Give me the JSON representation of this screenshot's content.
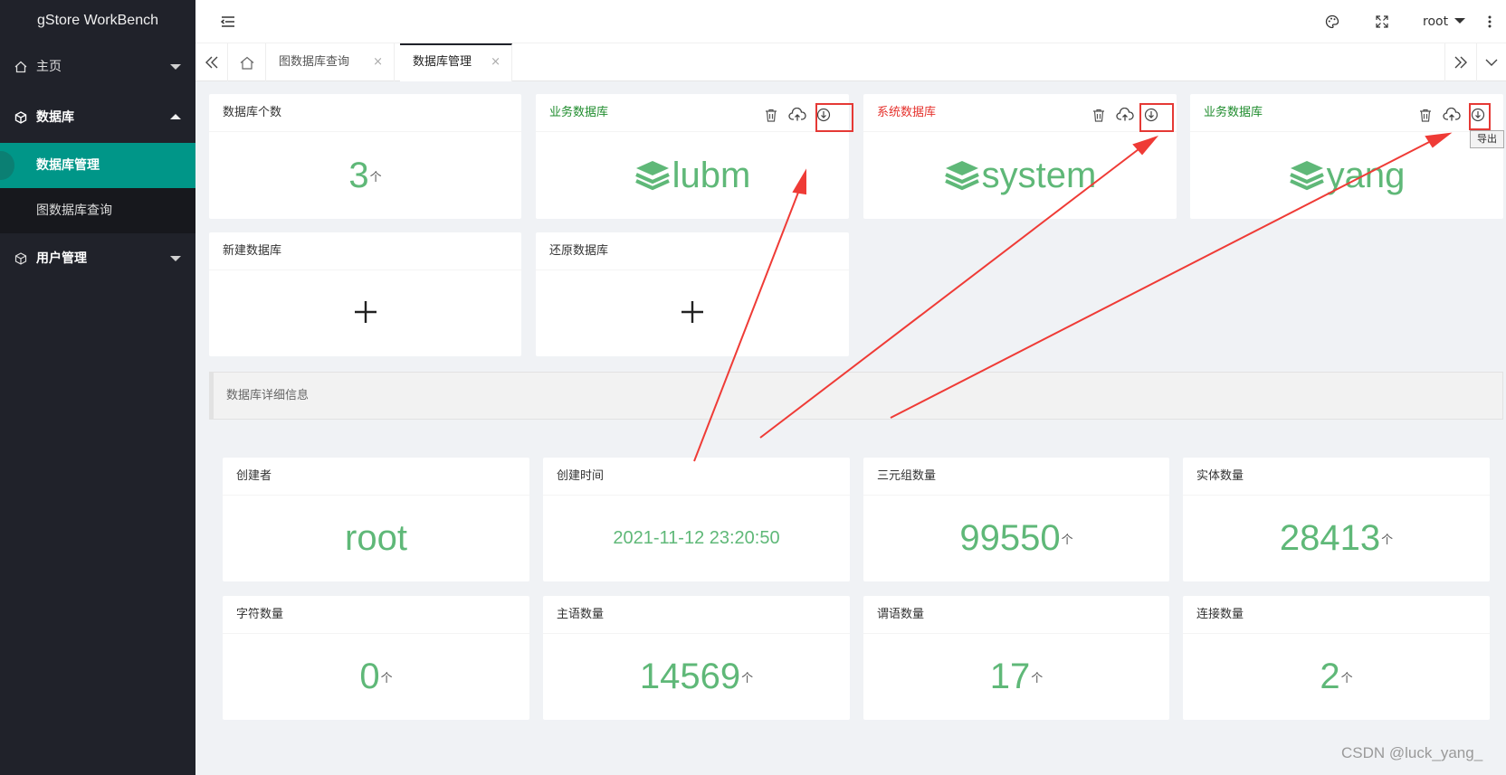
{
  "app": {
    "title": "gStore WorkBench"
  },
  "sidebar": {
    "items": [
      {
        "label": "主页",
        "icon": "home-icon"
      },
      {
        "label": "数据库",
        "icon": "cube-icon"
      },
      {
        "label": "用户管理",
        "icon": "cube-icon"
      }
    ],
    "sub_items": [
      {
        "label": "数据库管理",
        "active": true
      },
      {
        "label": "图数据库查询",
        "active": false
      }
    ]
  },
  "header": {
    "user": "root"
  },
  "tabs": [
    {
      "label": "图数据库查询",
      "active": false
    },
    {
      "label": "数据库管理",
      "active": true
    }
  ],
  "db_count": {
    "label": "数据库个数",
    "value": "3",
    "unit": "个"
  },
  "databases": [
    {
      "type_label": "业务数据库",
      "type_color": "#1f8c2d",
      "name": "lubm"
    },
    {
      "type_label": "系统数据库",
      "type_color": "#e5322d",
      "name": "system"
    },
    {
      "type_label": "业务数据库",
      "type_color": "#1f8c2d",
      "name": "yang"
    }
  ],
  "actions": {
    "new_db": "新建数据库",
    "restore_db": "还原数据库",
    "export_tooltip": "导出"
  },
  "detail": {
    "title": "数据库详细信息",
    "stats": [
      {
        "label": "创建者",
        "value": "root",
        "unit": ""
      },
      {
        "label": "创建时间",
        "value": "2021-11-12 23:20:50",
        "unit": ""
      },
      {
        "label": "三元组数量",
        "value": "99550",
        "unit": "个"
      },
      {
        "label": "实体数量",
        "value": "28413",
        "unit": "个"
      },
      {
        "label": "字符数量",
        "value": "0",
        "unit": "个"
      },
      {
        "label": "主语数量",
        "value": "14569",
        "unit": "个"
      },
      {
        "label": "谓语数量",
        "value": "17",
        "unit": "个"
      },
      {
        "label": "连接数量",
        "value": "2",
        "unit": "个"
      }
    ]
  },
  "watermark": "CSDN @luck_yang_",
  "colors": {
    "accent": "#009688",
    "number": "#5fb878",
    "sidebar_bg": "#20222a",
    "highlight": "#e53935"
  }
}
